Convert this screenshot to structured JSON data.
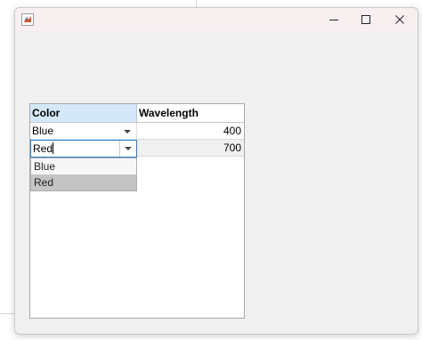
{
  "window": {
    "title": "",
    "controls": {
      "minimize_icon": "minimize-icon",
      "maximize_icon": "maximize-icon",
      "close_icon": "close-icon"
    }
  },
  "table": {
    "columns": [
      "Color",
      "Wavelength"
    ],
    "rows": [
      {
        "color": "Blue",
        "wavelength": "400"
      },
      {
        "color": "Red",
        "wavelength": "700"
      }
    ],
    "editor": {
      "value": "Red"
    },
    "dropdown": {
      "options": [
        "Blue",
        "Red"
      ],
      "highlighted": "Red"
    },
    "colors": {
      "header_selected": "#d5e8fa",
      "editor_border": "#2b7bd0",
      "highlight": "#c4c4c4"
    }
  }
}
